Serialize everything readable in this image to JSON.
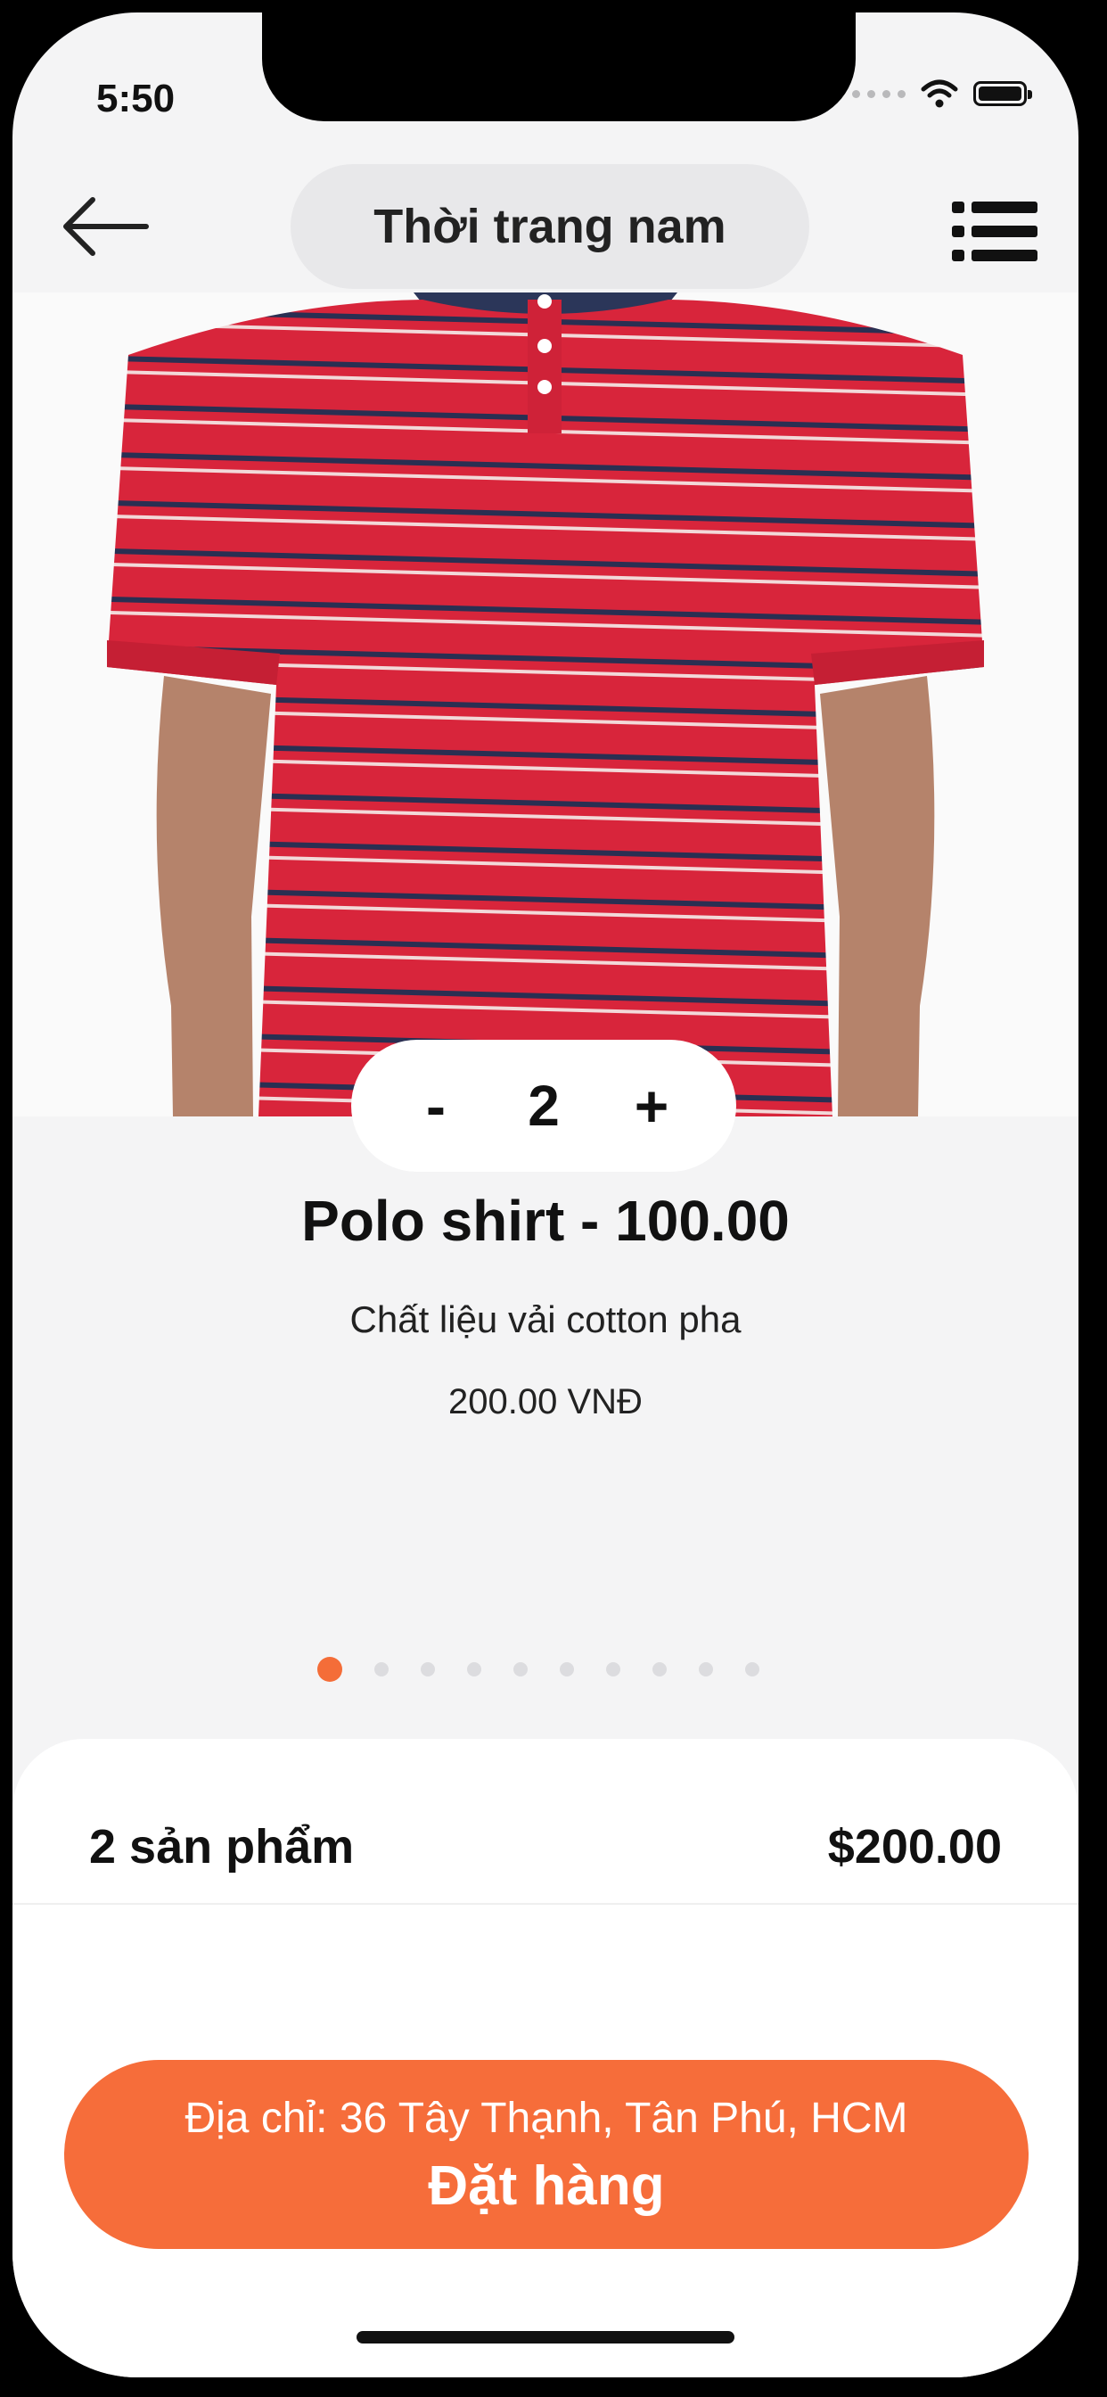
{
  "status_bar": {
    "time": "5:50"
  },
  "header": {
    "title": "Thời trang nam"
  },
  "product": {
    "quantity": "2",
    "minus_label": "-",
    "plus_label": "+",
    "name": "Polo shirt - 100.00",
    "description": "Chất liệu vải cotton pha",
    "price": "200.00 VNĐ"
  },
  "pagination": {
    "count": 10,
    "active_index": 0
  },
  "cart": {
    "count_label": "2 sản phẩm",
    "total": "$200.00"
  },
  "order_button": {
    "address": "Địa chỉ: 36 Tây Thạnh, Tân Phú, HCM",
    "label": "Đặt hàng"
  },
  "colors": {
    "accent": "#f66d3a",
    "shirt_red": "#d8253b",
    "stripe_navy": "#2a2f52",
    "background": "#f4f4f5"
  },
  "icons": [
    "back-arrow-icon",
    "list-menu-icon",
    "wifi-icon",
    "battery-icon",
    "signal-icon"
  ]
}
